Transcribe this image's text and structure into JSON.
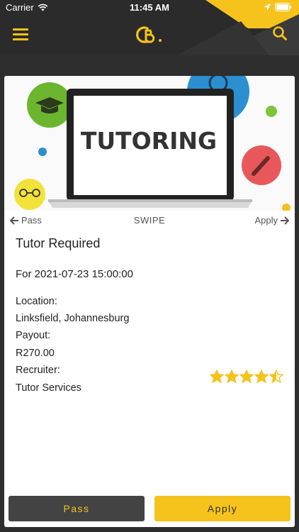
{
  "status_bar": {
    "carrier": "Carrier",
    "time": "11:45 AM"
  },
  "header": {
    "logo_text": "CB.",
    "menu_icon": "hamburger-icon",
    "search_icon": "search-icon"
  },
  "banner": {
    "text": "TUTORING"
  },
  "swipe": {
    "pass_label": "Pass",
    "center_label": "SWIPE",
    "apply_label": "Apply"
  },
  "job": {
    "title": "Tutor Required",
    "date_line": "For 2021-07-23 15:00:00",
    "location_label": "Location:",
    "location_value": "Linksfield, Johannesburg",
    "payout_label": "Payout:",
    "payout_value": "R270.00",
    "recruiter_label": "Recruiter:",
    "recruiter_value": "Tutor Services",
    "rating": 4.5
  },
  "buttons": {
    "pass": "Pass",
    "apply": "Apply"
  },
  "colors": {
    "accent": "#f6c21c",
    "dark": "#2b2b2b",
    "button_dark": "#434343"
  }
}
